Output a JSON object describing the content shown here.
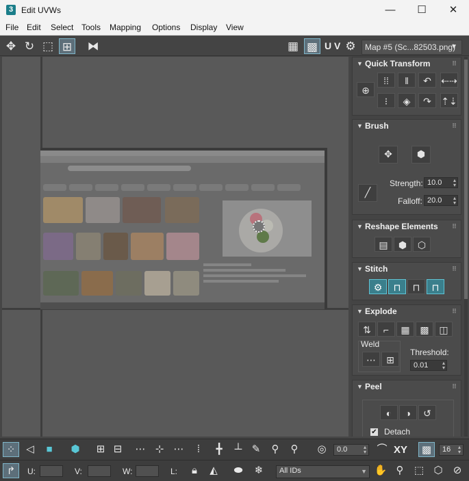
{
  "window": {
    "title": "Edit UVWs",
    "app_icon_text": "3",
    "minimize": "—",
    "maximize": "☐",
    "close": "✕"
  },
  "menu": [
    "File",
    "Edit",
    "Select",
    "Tools",
    "Mapping",
    "Options",
    "Display",
    "View"
  ],
  "toolbar_top": {
    "uv_label": "U V",
    "map_dropdown": "Map #5 (Sc...82503.png)"
  },
  "right_panel": {
    "quick_transform": {
      "title": "Quick Transform"
    },
    "brush": {
      "title": "Brush",
      "strength_label": "Strength:",
      "strength_value": "10.0",
      "falloff_label": "Falloff:",
      "falloff_value": "20.0"
    },
    "reshape": {
      "title": "Reshape Elements"
    },
    "stitch": {
      "title": "Stitch"
    },
    "explode": {
      "title": "Explode",
      "weld_label": "Weld",
      "threshold_label": "Threshold:",
      "threshold_value": "0.01"
    },
    "peel": {
      "title": "Peel",
      "detach_label": "Detach",
      "detach_checked": true
    }
  },
  "bottom1": {
    "rotate_value": "0.0",
    "xy_label": "XY",
    "grid_value": "16"
  },
  "bottom2": {
    "u_label": "U:",
    "v_label": "V:",
    "w_label": "W:",
    "l_label": "L:",
    "ids_dropdown": "All IDs"
  },
  "colors": {
    "accent_cyan": "#3a7f8c",
    "background": "#464646"
  }
}
